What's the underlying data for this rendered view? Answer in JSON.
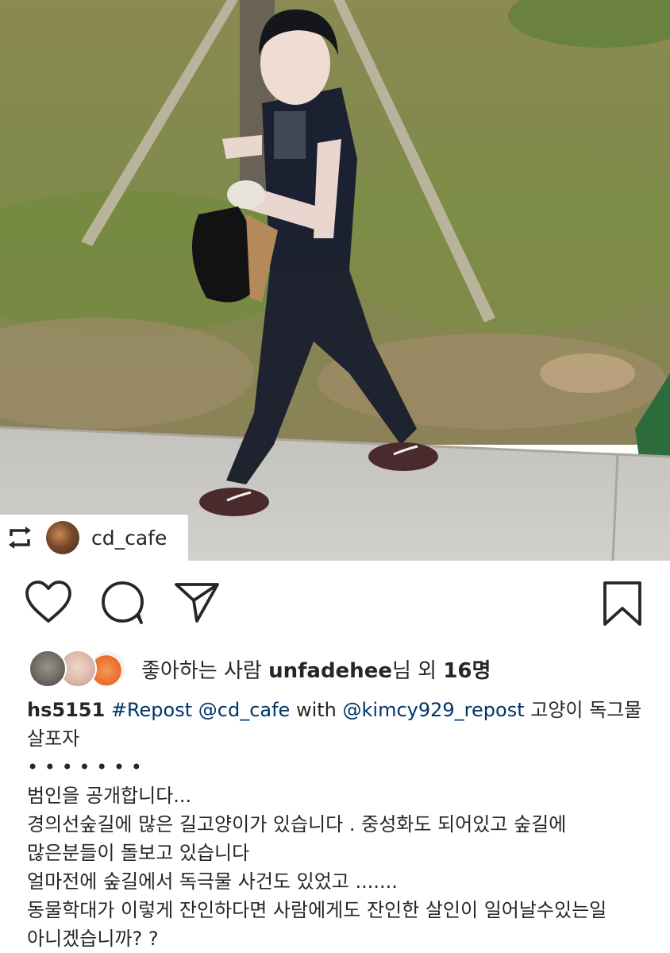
{
  "post": {
    "repost_username": "cd_cafe",
    "icons": {
      "repost": "repost-icon",
      "like": "heart-icon",
      "comment": "comment-icon",
      "share": "send-icon",
      "save": "bookmark-icon"
    },
    "likes": {
      "prefix": "좋아하는 사람 ",
      "user": "unfadehee",
      "suffix": "님 외 ",
      "count": "16명"
    },
    "caption": {
      "username": "hs5151",
      "tag_repost": "#Repost",
      "mention_1": "@cd_cafe",
      "with": "with",
      "mention_2": "@kimcy929_repost",
      "title_1": "고양이 독그물",
      "title_2": "살포자",
      "dots": "• • • • • • •",
      "lines": [
        "범인을 공개합니다...",
        "경의선숲길에 많은 길고양이가 있습니다 . 중성화도 되어있고 숲길에",
        "많은분들이 돌보고 있습니다",
        "얼마전에 숲길에서 독극물 사건도 있었고 .......",
        "동물학대가 이렇게 잔인하다면 사람에게도 잔인한 살인이 일어날수있는일",
        "아니겠습니까? ?"
      ]
    }
  }
}
